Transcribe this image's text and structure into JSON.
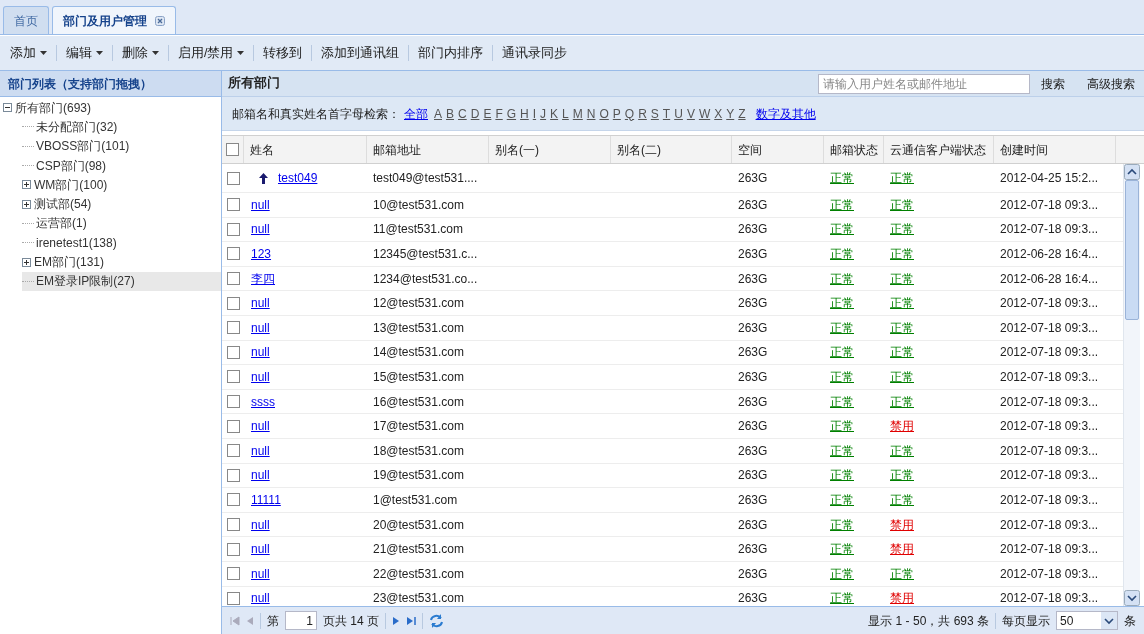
{
  "tabs": [
    {
      "label": "首页",
      "selected": false,
      "closable": false
    },
    {
      "label": "部门及用户管理",
      "selected": true,
      "closable": true
    }
  ],
  "toolbar": [
    {
      "label": "添加",
      "dropdown": true
    },
    {
      "label": "编辑",
      "dropdown": true
    },
    {
      "label": "删除",
      "dropdown": true
    },
    {
      "label": "启用/禁用",
      "dropdown": true
    },
    {
      "label": "转移到",
      "dropdown": false
    },
    {
      "label": "添加到通讯组",
      "dropdown": false
    },
    {
      "label": "部门内排序",
      "dropdown": false
    },
    {
      "label": "通讯录同步",
      "dropdown": false
    }
  ],
  "sidebar": {
    "title": "部门列表（支持部门拖拽）",
    "tree": [
      {
        "label": "所有部门(693)",
        "expanded": true,
        "selected": false,
        "children": [
          {
            "label": "未分配部门(32)",
            "selected": false
          },
          {
            "label": "VBOSS部门(101)",
            "selected": false
          },
          {
            "label": "CSP部门(98)",
            "selected": false
          },
          {
            "label": "WM部门(100)",
            "expanded": false,
            "selected": false
          },
          {
            "label": "测试部(54)",
            "expanded": false,
            "selected": false
          },
          {
            "label": "运营部(1)",
            "selected": false
          },
          {
            "label": "irenetest1(138)",
            "selected": false
          },
          {
            "label": "EM部门(131)",
            "expanded": false,
            "selected": false
          },
          {
            "label": "EM登录IP限制(27)",
            "selected": true
          }
        ]
      }
    ]
  },
  "main": {
    "title": "所有部门",
    "search": {
      "placeholder": "请输入用户姓名或邮件地址",
      "button": "搜索",
      "advanced": "高级搜索"
    },
    "letter_filter": {
      "label": "邮箱名和真实姓名首字母检索：",
      "all": "全部",
      "letters": [
        "A",
        "B",
        "C",
        "D",
        "E",
        "F",
        "G",
        "H",
        "I",
        "J",
        "K",
        "L",
        "M",
        "N",
        "O",
        "P",
        "Q",
        "R",
        "S",
        "T",
        "U",
        "V",
        "W",
        "X",
        "Y",
        "Z"
      ],
      "other": "数字及其他"
    },
    "table": {
      "select_all_checked": false,
      "columns": [
        "姓名",
        "邮箱地址",
        "别名(一)",
        "别名(二)",
        "空间",
        "邮箱状态",
        "云通信客户端状态",
        "创建时间"
      ],
      "rows": [
        {
          "kind": "up",
          "checked": false,
          "name": "test049",
          "email": "test049@test531....",
          "space": "263G",
          "mail_status": "正常",
          "mail_ok": true,
          "client_status": "正常",
          "client_ok": true,
          "created": "2012-04-25 15:2..."
        },
        {
          "kind": "plain",
          "checked": false,
          "name": "null",
          "email": "10@test531.com",
          "space": "263G",
          "mail_status": "正常",
          "mail_ok": true,
          "client_status": "正常",
          "client_ok": true,
          "created": "2012-07-18 09:3..."
        },
        {
          "kind": "plain",
          "checked": false,
          "name": "null",
          "email": "11@test531.com",
          "space": "263G",
          "mail_status": "正常",
          "mail_ok": true,
          "client_status": "正常",
          "client_ok": true,
          "created": "2012-07-18 09:3..."
        },
        {
          "kind": "plain",
          "checked": false,
          "name": "123",
          "email": "12345@test531.c...",
          "space": "263G",
          "mail_status": "正常",
          "mail_ok": true,
          "client_status": "正常",
          "client_ok": true,
          "created": "2012-06-28 16:4..."
        },
        {
          "kind": "plain",
          "checked": false,
          "name": "李四",
          "email": "1234@test531.co...",
          "space": "263G",
          "mail_status": "正常",
          "mail_ok": true,
          "client_status": "正常",
          "client_ok": true,
          "created": "2012-06-28 16:4..."
        },
        {
          "kind": "plain",
          "checked": false,
          "name": "null",
          "email": "12@test531.com",
          "space": "263G",
          "mail_status": "正常",
          "mail_ok": true,
          "client_status": "正常",
          "client_ok": true,
          "created": "2012-07-18 09:3..."
        },
        {
          "kind": "plain",
          "checked": false,
          "name": "null",
          "email": "13@test531.com",
          "space": "263G",
          "mail_status": "正常",
          "mail_ok": true,
          "client_status": "正常",
          "client_ok": true,
          "created": "2012-07-18 09:3..."
        },
        {
          "kind": "plain",
          "checked": false,
          "name": "null",
          "email": "14@test531.com",
          "space": "263G",
          "mail_status": "正常",
          "mail_ok": true,
          "client_status": "正常",
          "client_ok": true,
          "created": "2012-07-18 09:3..."
        },
        {
          "kind": "plain",
          "checked": false,
          "name": "null",
          "email": "15@test531.com",
          "space": "263G",
          "mail_status": "正常",
          "mail_ok": true,
          "client_status": "正常",
          "client_ok": true,
          "created": "2012-07-18 09:3..."
        },
        {
          "kind": "plain",
          "checked": false,
          "name": "ssss",
          "email": "16@test531.com",
          "space": "263G",
          "mail_status": "正常",
          "mail_ok": true,
          "client_status": "正常",
          "client_ok": true,
          "created": "2012-07-18 09:3..."
        },
        {
          "kind": "plain",
          "checked": false,
          "name": "null",
          "email": "17@test531.com",
          "space": "263G",
          "mail_status": "正常",
          "mail_ok": true,
          "client_status": "禁用",
          "client_ok": false,
          "created": "2012-07-18 09:3..."
        },
        {
          "kind": "plain",
          "checked": false,
          "name": "null",
          "email": "18@test531.com",
          "space": "263G",
          "mail_status": "正常",
          "mail_ok": true,
          "client_status": "正常",
          "client_ok": true,
          "created": "2012-07-18 09:3..."
        },
        {
          "kind": "plain",
          "checked": false,
          "name": "null",
          "email": "19@test531.com",
          "space": "263G",
          "mail_status": "正常",
          "mail_ok": true,
          "client_status": "正常",
          "client_ok": true,
          "created": "2012-07-18 09:3..."
        },
        {
          "kind": "plain",
          "checked": false,
          "name": "11111",
          "email": "1@test531.com",
          "space": "263G",
          "mail_status": "正常",
          "mail_ok": true,
          "client_status": "正常",
          "client_ok": true,
          "created": "2012-07-18 09:3..."
        },
        {
          "kind": "plain",
          "checked": false,
          "name": "null",
          "email": "20@test531.com",
          "space": "263G",
          "mail_status": "正常",
          "mail_ok": true,
          "client_status": "禁用",
          "client_ok": false,
          "created": "2012-07-18 09:3..."
        },
        {
          "kind": "plain",
          "checked": false,
          "name": "null",
          "email": "21@test531.com",
          "space": "263G",
          "mail_status": "正常",
          "mail_ok": true,
          "client_status": "禁用",
          "client_ok": false,
          "created": "2012-07-18 09:3..."
        },
        {
          "kind": "plain",
          "checked": false,
          "name": "null",
          "email": "22@test531.com",
          "space": "263G",
          "mail_status": "正常",
          "mail_ok": true,
          "client_status": "正常",
          "client_ok": true,
          "created": "2012-07-18 09:3..."
        },
        {
          "kind": "plain",
          "checked": false,
          "name": "null",
          "email": "23@test531.com",
          "space": "263G",
          "mail_status": "正常",
          "mail_ok": true,
          "client_status": "禁用",
          "client_ok": false,
          "created": "2012-07-18 09:3..."
        }
      ]
    },
    "pager": {
      "page_prefix": "第",
      "page": "1",
      "page_suffix": "页共 14 页",
      "summary": "显示 1 - 50，共 693 条",
      "per_page_label": "每页显示",
      "per_page": "50",
      "per_page_unit": "条"
    }
  }
}
